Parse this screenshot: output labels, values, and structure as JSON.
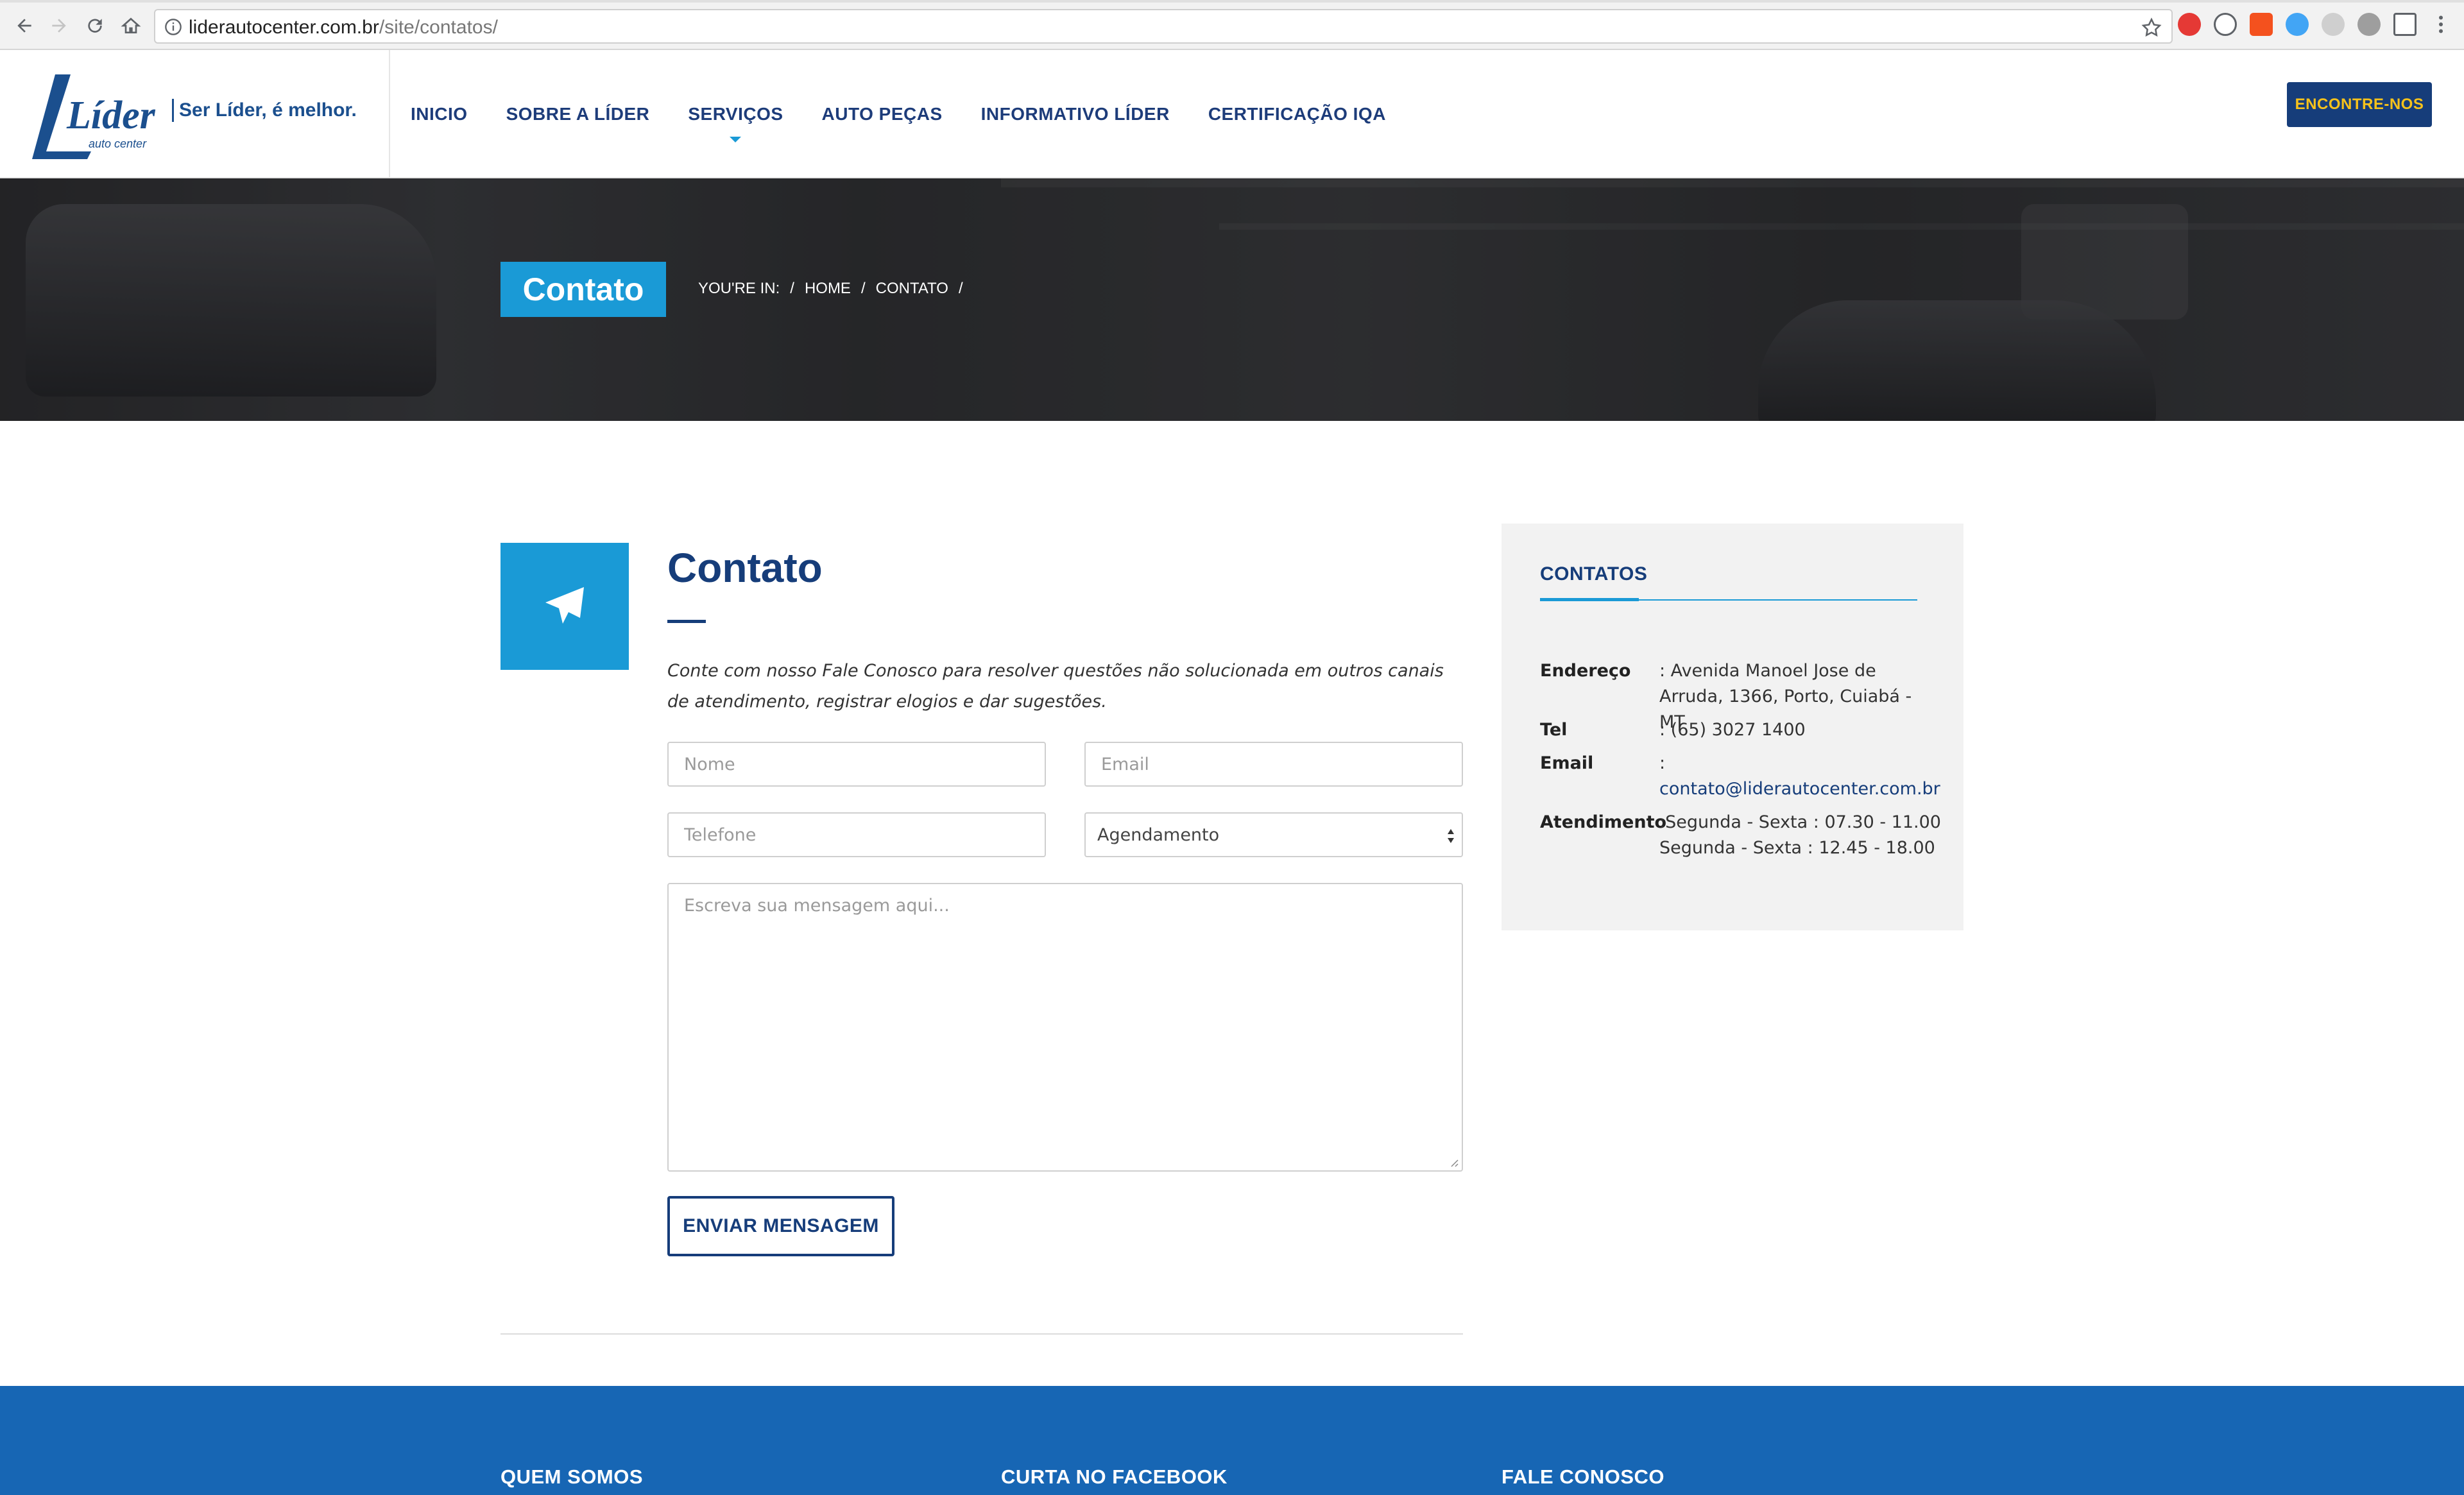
{
  "browser": {
    "url_host": "liderautocenter.com.br",
    "url_path": "/site/contatos/"
  },
  "header": {
    "logo_text": "Líder",
    "logo_subtext": "auto center",
    "slogan": "Ser Líder, é melhor.",
    "nav": [
      {
        "label": "INICIO"
      },
      {
        "label": "SOBRE A LÍDER"
      },
      {
        "label": "SERVIÇOS"
      },
      {
        "label": "AUTO PEÇAS"
      },
      {
        "label": "INFORMATIVO LÍDER"
      },
      {
        "label": "CERTIFICAÇÃO IQA"
      }
    ],
    "cta_label": "ENCONTRE-NOS"
  },
  "hero": {
    "title": "Contato",
    "breadcrumb": {
      "prefix": "YOU'RE IN:",
      "sep": "/",
      "home": "HOME",
      "current": "CONTATO"
    }
  },
  "main": {
    "icon": "paper-plane-icon",
    "title": "Contato",
    "intro": "Conte com nosso Fale Conosco para resolver questões não solucionada em outros canais de atendimento, registrar elogios e dar sugestões.",
    "form": {
      "name_placeholder": "Nome",
      "email_placeholder": "Email",
      "phone_placeholder": "Telefone",
      "subject_selected": "Agendamento",
      "message_placeholder": "Escreva sua mensagem aqui...",
      "submit_label": "ENVIAR MENSAGEM"
    }
  },
  "sidebar": {
    "title": "CONTATOS",
    "rows": [
      {
        "key": "Endereço",
        "value": ": Avenida Manoel Jose de Arruda, 1366, Porto, Cuiabá - MT"
      },
      {
        "key": "Tel",
        "value": ": (65) 3027 1400"
      },
      {
        "key": "Email",
        "value": ":",
        "link": "contato@liderautocenter.com.br"
      },
      {
        "key": "Atendimento",
        "value": ":Segunda - Sexta : 07.30 - 11.00",
        "value2": "Segunda - Sexta : 12.45 - 18.00"
      }
    ]
  },
  "footer": {
    "headings": [
      "QUEM SOMOS",
      "CURTA NO FACEBOOK",
      "FALE CONOSCO"
    ]
  },
  "colors": {
    "brand_blue": "#163d7a",
    "accent_cyan": "#1a9ad6",
    "cta_text": "#f7c21b",
    "footer_blue": "#1766b4"
  }
}
